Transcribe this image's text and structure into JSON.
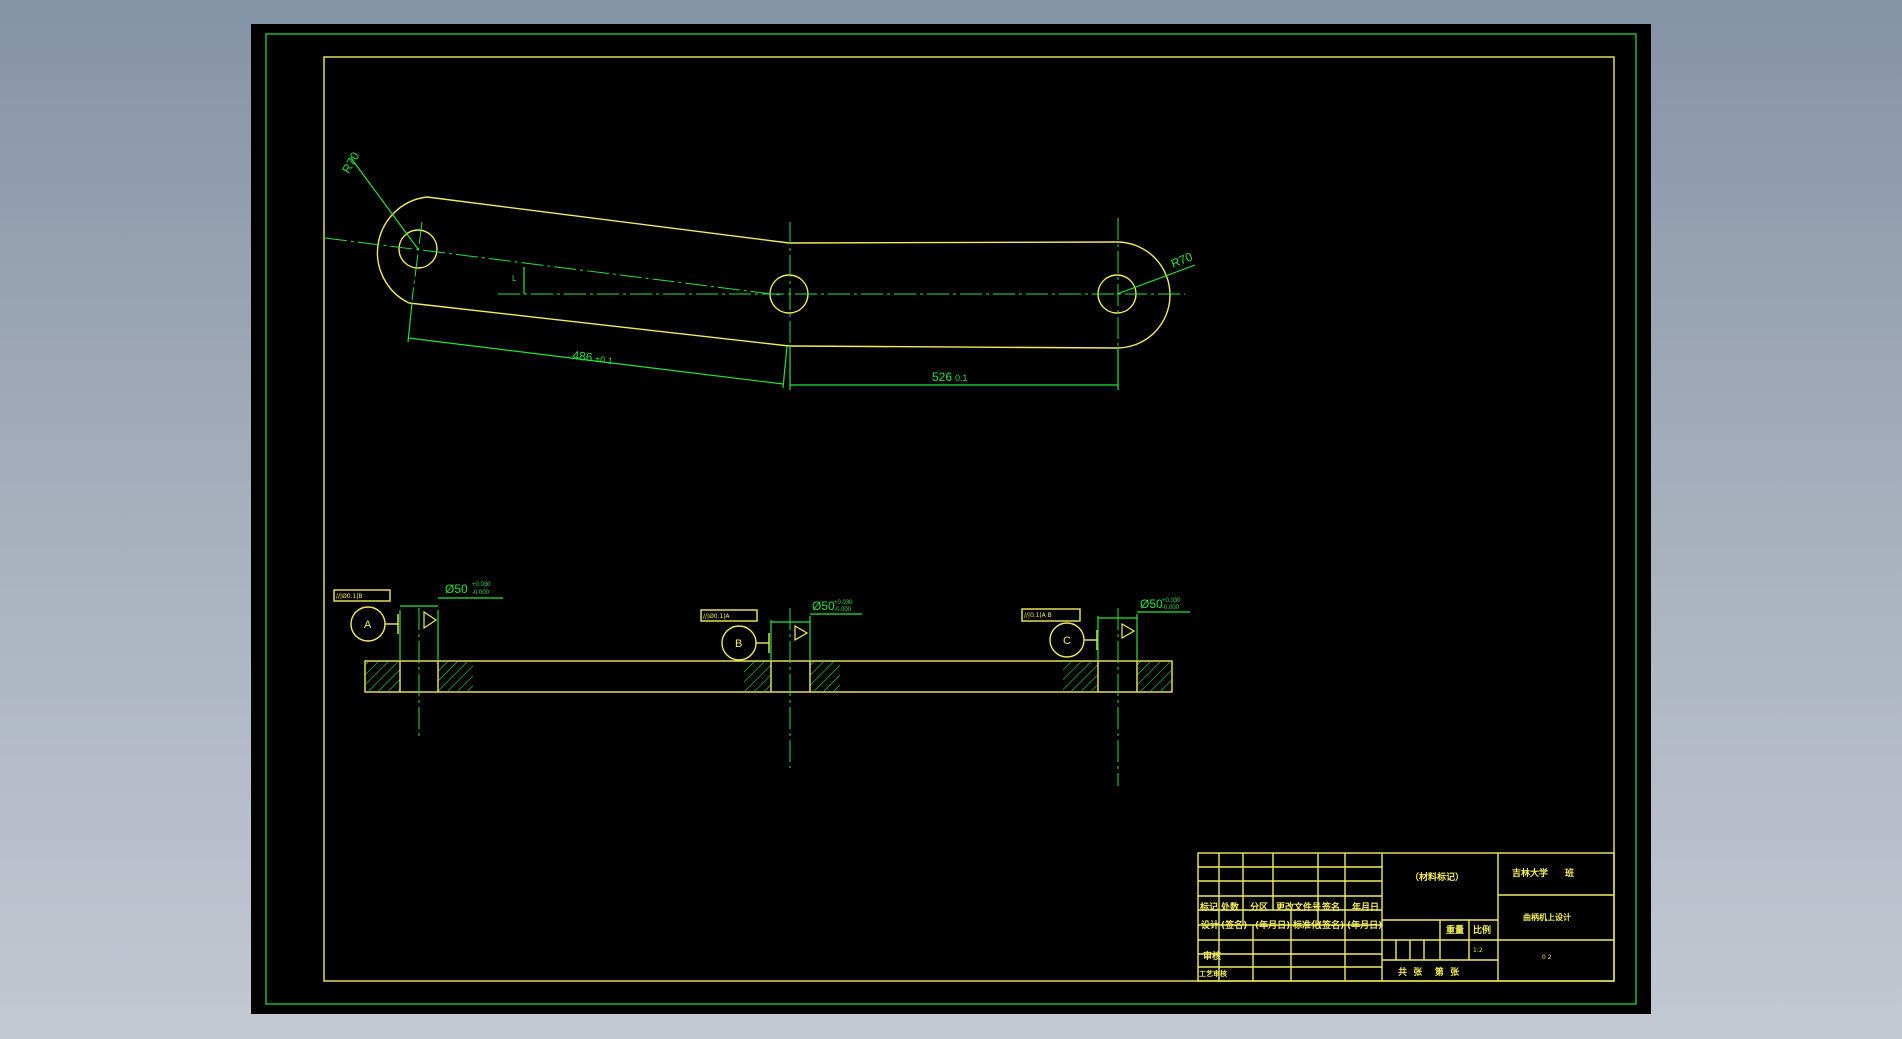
{
  "colors": {
    "background": "#000000",
    "outline": "#f2ec5a",
    "dimension": "#27e23a"
  },
  "plan_view": {
    "radius_left_label": "R70",
    "radius_right_label": "R70",
    "offset_label": "L",
    "dim_left": {
      "value": "486",
      "tol": "±0.1"
    },
    "dim_right": {
      "value": "526",
      "tol": "0.1"
    }
  },
  "section_view": {
    "datums": [
      {
        "letter": "A",
        "fcf": "//|Ø0.1|B",
        "dia": "Ø50",
        "tol_up": "+0.030",
        "tol_lo": "-0.000"
      },
      {
        "letter": "B",
        "fcf": "//|Ø0.1|A",
        "dia": "Ø50",
        "tol_up": "+0.030",
        "tol_lo": "-0.000"
      },
      {
        "letter": "C",
        "fcf": "//|0.1|A B",
        "dia": "Ø50",
        "tol_up": "+0.030",
        "tol_lo": "-0.000"
      }
    ]
  },
  "title_block": {
    "material": "（材料标记）",
    "school": "吉林大学",
    "class": "班",
    "drawing_name": "曲柄机上设计",
    "header_row": [
      "标记",
      "处数",
      "分区",
      "更改文件号",
      "签名",
      "年月日"
    ],
    "design_row": [
      "设计",
      "(签名)",
      "(年月日)",
      "标准化",
      "(签名)",
      "(年月日)"
    ],
    "weight_label": "重量",
    "scale_label": "比例",
    "scale_value": "1:2",
    "audit_label": "审核",
    "craft_label": "工艺审核",
    "sheets_label": "共  张    第  张",
    "drawing_no": "0 2"
  }
}
